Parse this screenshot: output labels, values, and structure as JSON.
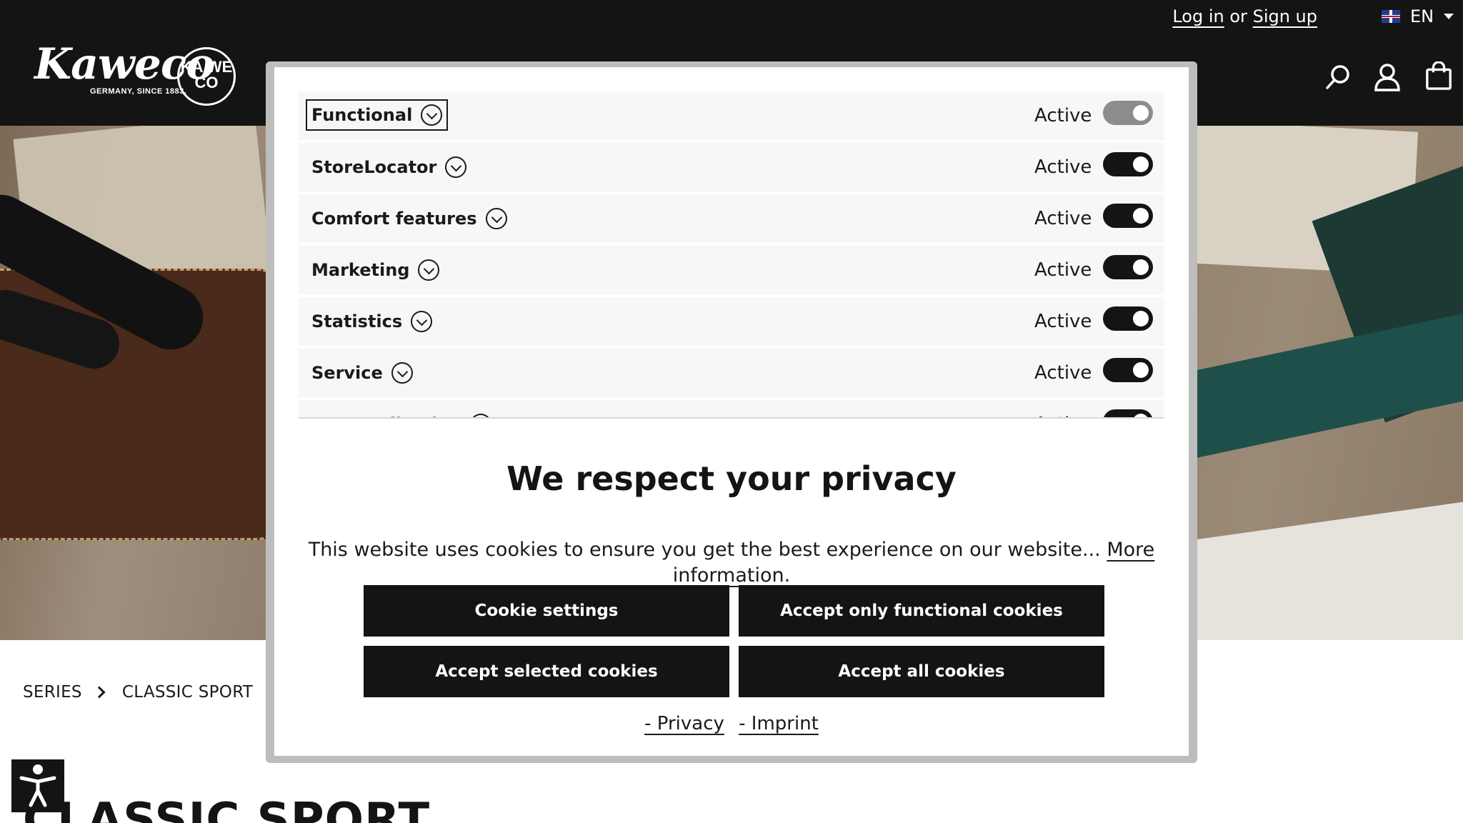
{
  "header": {
    "login_label": "Log in",
    "or_label": "or",
    "signup_label": "Sign up",
    "language": "EN",
    "logo_text": "Kaweco",
    "logo_subtext": "GERMANY, SINCE 1883.",
    "seal_text": "KA WE CO",
    "icons": [
      "search-icon",
      "account-icon",
      "cart-icon"
    ]
  },
  "breadcrumb": {
    "items": [
      "SERIES",
      "CLASSIC SPORT"
    ]
  },
  "page": {
    "title_visible": "CLASSIC SPORT"
  },
  "cookie_modal": {
    "categories": [
      {
        "name": "Functional",
        "status": "Active",
        "enabled": true,
        "locked": true
      },
      {
        "name": "StoreLocator",
        "status": "Active",
        "enabled": true,
        "locked": false
      },
      {
        "name": "Comfort features",
        "status": "Active",
        "enabled": true,
        "locked": false
      },
      {
        "name": "Marketing",
        "status": "Active",
        "enabled": true,
        "locked": false
      },
      {
        "name": "Statistics",
        "status": "Active",
        "enabled": true,
        "locked": false
      },
      {
        "name": "Service",
        "status": "Active",
        "enabled": true,
        "locked": false
      },
      {
        "name": "Personalization",
        "status": "Active",
        "enabled": true,
        "locked": false
      }
    ],
    "title": "We respect your privacy",
    "text": "This website uses cookies to ensure you get the best experience on our website... ",
    "more_info_label": "More information",
    "text_end": ".",
    "buttons": {
      "cookie_settings": "Cookie settings",
      "accept_functional": "Accept only functional cookies",
      "accept_selected": "Accept selected cookies",
      "accept_all": "Accept all cookies"
    },
    "footer_links": {
      "privacy": "- Privacy",
      "imprint": "- Imprint"
    }
  },
  "colors": {
    "dark": "#141412",
    "toggle_disabled": "#8c8c8c",
    "row_bg": "#f7f7f7"
  }
}
